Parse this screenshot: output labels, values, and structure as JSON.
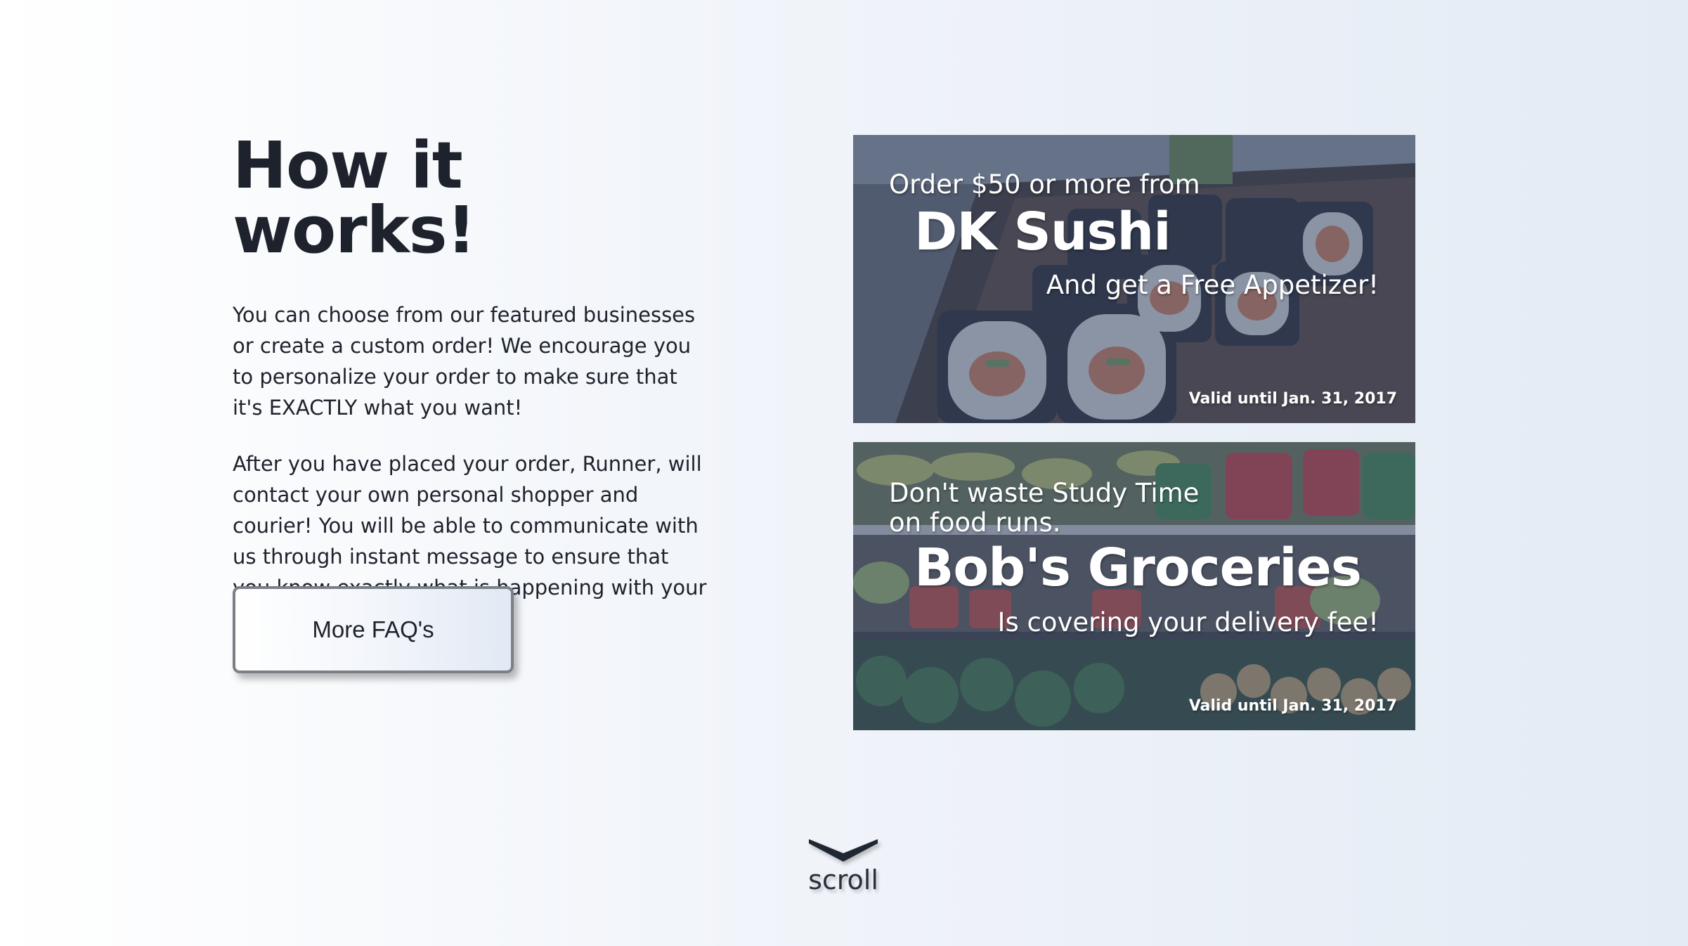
{
  "intro": {
    "heading": "How it works!",
    "paragraph_1": "You can choose from our featured businesses or create a custom order! We encourage you to personalize your order to make sure that it's EXACTLY what you want!",
    "paragraph_2": "After you have placed your order, Runner, will contact your own personal shopper and courier! You will be able to communicate with us through instant message to ensure that you know exactly what is happening with your order!",
    "faq_button": "More FAQ's"
  },
  "promos": [
    {
      "lead": "Order $50 or more from",
      "title": "DK Sushi",
      "subtitle": "And get a Free Appetizer!",
      "valid": "Valid until Jan. 31, 2017",
      "image": "sushi-photo"
    },
    {
      "lead": "Don't waste Study Time on food runs.",
      "title": "Bob's Groceries",
      "subtitle": "Is covering your delivery fee!",
      "valid": "Valid until Jan. 31, 2017",
      "image": "grocery-aisle-photo"
    }
  ],
  "scroll": {
    "label": "scroll",
    "icon": "chevron-down-icon"
  },
  "colors": {
    "text": "#1e222c",
    "overlay": "#3c4c6e",
    "button_border": "#7a7f88"
  }
}
